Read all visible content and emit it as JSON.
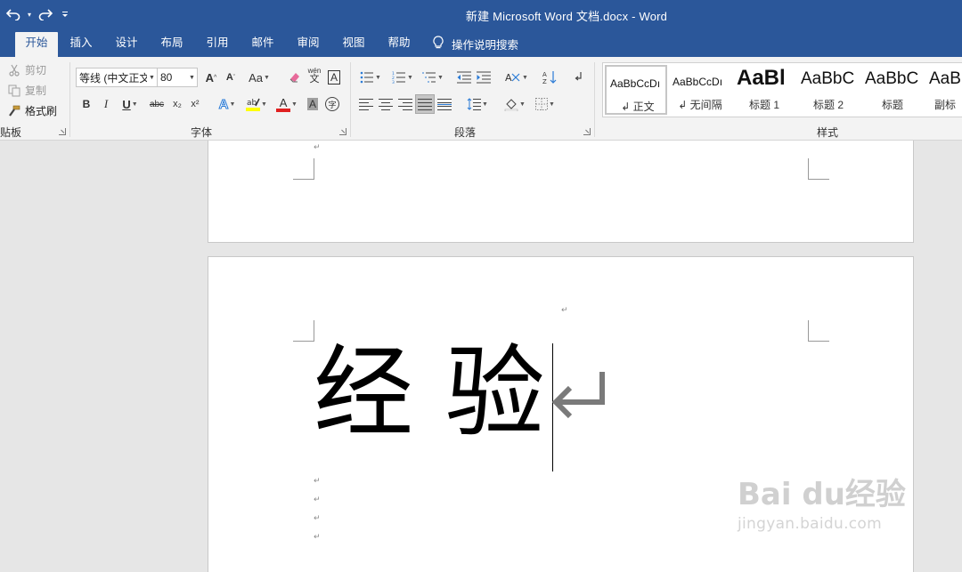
{
  "window": {
    "title": "新建 Microsoft Word 文档.docx  -  Word"
  },
  "quick_access": {
    "undo_icon": "undo-icon",
    "redo_icon": "redo-icon",
    "customize_icon": "customize-qat-icon"
  },
  "tabs": [
    {
      "label": "开始",
      "active": true
    },
    {
      "label": "插入"
    },
    {
      "label": "设计"
    },
    {
      "label": "布局"
    },
    {
      "label": "引用"
    },
    {
      "label": "邮件"
    },
    {
      "label": "审阅"
    },
    {
      "label": "视图"
    },
    {
      "label": "帮助"
    }
  ],
  "tell_me": {
    "label": "操作说明搜索",
    "icon": "lightbulb-icon"
  },
  "ribbon": {
    "clipboard": {
      "cut": "剪切",
      "copy": "复制",
      "format_painter": "格式刷",
      "group_label": "贴板"
    },
    "font": {
      "font_name": "等线 (中文正文",
      "font_size": "80",
      "change_case": "Aa",
      "wen_label": "wén",
      "wen_char": "文",
      "border_char": "A",
      "bold": "B",
      "italic": "I",
      "underline": "U",
      "strike": "abc",
      "subscript": "x₂",
      "superscript": "x²",
      "enclose_char": "字",
      "group_label": "字体",
      "highlight_color": "#ffff00",
      "font_color": "#e02020"
    },
    "paragraph": {
      "group_label": "段落"
    },
    "styles": {
      "group_label": "样式",
      "items": [
        {
          "sample": "AaBbCcDı",
          "name": "↲ 正文",
          "selected": true
        },
        {
          "sample": "AaBbCcDı",
          "name": "↲ 无间隔"
        },
        {
          "sample": "AaBl",
          "name": "标题 1"
        },
        {
          "sample": "AaBbC",
          "name": "标题 2"
        },
        {
          "sample": "AaBbC",
          "name": "标题"
        },
        {
          "sample": "AaB",
          "name": "副标"
        }
      ]
    }
  },
  "document": {
    "big_text": "经  验",
    "paragraph_mark": "↵"
  },
  "watermark": {
    "main": "Bai du经验",
    "sub": "jingyan.baidu.com"
  }
}
